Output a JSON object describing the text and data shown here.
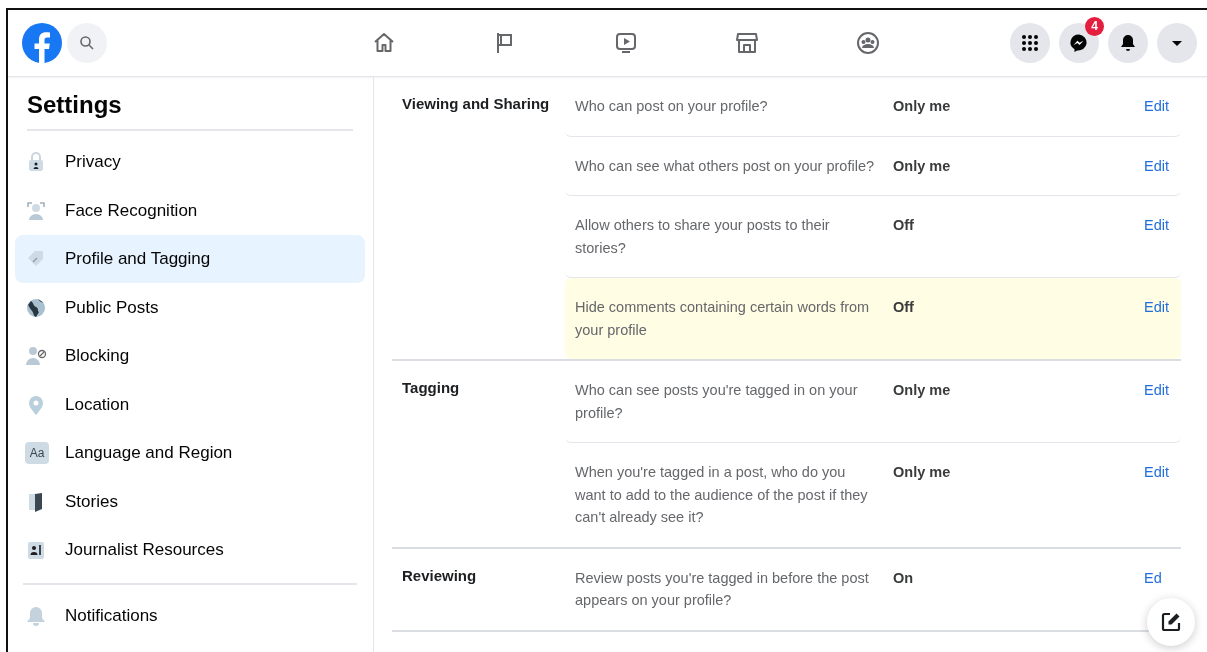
{
  "top_bar": {
    "nav": [
      {
        "kind": "home"
      },
      {
        "kind": "flag"
      },
      {
        "kind": "video"
      },
      {
        "kind": "store"
      },
      {
        "kind": "groups"
      }
    ],
    "actions": [
      {
        "kind": "menu"
      },
      {
        "kind": "messenger",
        "badge": "4"
      },
      {
        "kind": "notifications"
      },
      {
        "kind": "account"
      }
    ]
  },
  "sidebar": {
    "title": "Settings",
    "groups": [
      {
        "items": [
          {
            "label": "Privacy",
            "kind": "lock",
            "selected": false
          },
          {
            "label": "Face Recognition",
            "kind": "face",
            "selected": false
          },
          {
            "label": "Profile and Tagging",
            "kind": "tag",
            "selected": true
          },
          {
            "label": "Public Posts",
            "kind": "globe",
            "selected": false
          },
          {
            "label": "Blocking",
            "kind": "block",
            "selected": false
          },
          {
            "label": "Location",
            "kind": "pin",
            "selected": false
          },
          {
            "label": "Language and Region",
            "kind": "text",
            "icon_text": "Aa",
            "selected": false
          },
          {
            "label": "Stories",
            "kind": "book",
            "selected": false
          },
          {
            "label": "Journalist Resources",
            "kind": "badge",
            "selected": false
          }
        ]
      },
      {
        "items": [
          {
            "label": "Notifications",
            "kind": "bell",
            "selected": false
          }
        ]
      }
    ]
  },
  "sections": [
    {
      "title": "Viewing and Sharing",
      "rows": [
        {
          "question": "Who can post on your profile?",
          "value": "Only me",
          "action": "Edit",
          "highlighted": false
        },
        {
          "question": "Who can see what others post on your profile?",
          "value": "Only me",
          "action": "Edit",
          "highlighted": false
        },
        {
          "question": "Allow others to share your posts to their stories?",
          "value": "Off",
          "action": "Edit",
          "highlighted": false
        },
        {
          "question": "Hide comments containing certain words from your profile",
          "value": "Off",
          "action": "Edit",
          "highlighted": true
        }
      ]
    },
    {
      "title": "Tagging",
      "rows": [
        {
          "question": "Who can see posts you're tagged in on your profile?",
          "value": "Only me",
          "action": "Edit",
          "highlighted": false
        },
        {
          "question": "When you're tagged in a post, who do you want to add to the audience of the post if they can't already see it?",
          "value": "Only me",
          "action": "Edit",
          "highlighted": false
        }
      ]
    },
    {
      "title": "Reviewing",
      "rows": [
        {
          "question": "Review posts you're tagged in before the post appears on your profile?",
          "value": "On",
          "action": "Ed",
          "highlighted": false
        }
      ]
    }
  ]
}
